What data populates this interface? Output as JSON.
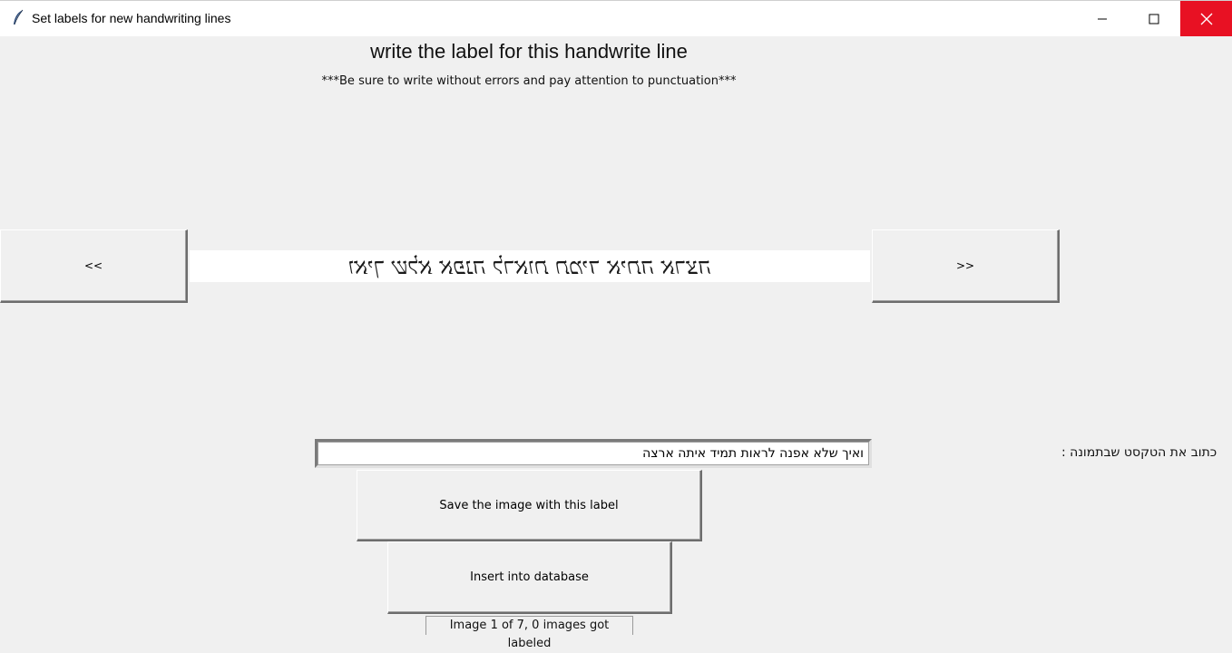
{
  "window": {
    "title": "Set labels for new handwriting lines",
    "icon": "feather-icon",
    "controls": [
      "minimize-icon",
      "maximize-icon",
      "close-icon"
    ],
    "close_hover_color": "#e81123"
  },
  "main": {
    "heading": "write the label for this handwrite line",
    "subheading": "***Be sure to write without errors and pay attention to punctuation***",
    "prev_label": "<<",
    "next_label": ">>",
    "handwriting_image_text": "ואיך שלא אפנה לראות תמיד איתה ארצה",
    "text_prompt": ": כתוב את הטקסט שבתמונה",
    "label_value": "ואיך שלא אפנה לראות תמיד איתה ארצה",
    "save_label": "Save the image with this label",
    "insert_label": "Insert into database",
    "status": "Image 1 of 7, 0 images got labeled"
  }
}
